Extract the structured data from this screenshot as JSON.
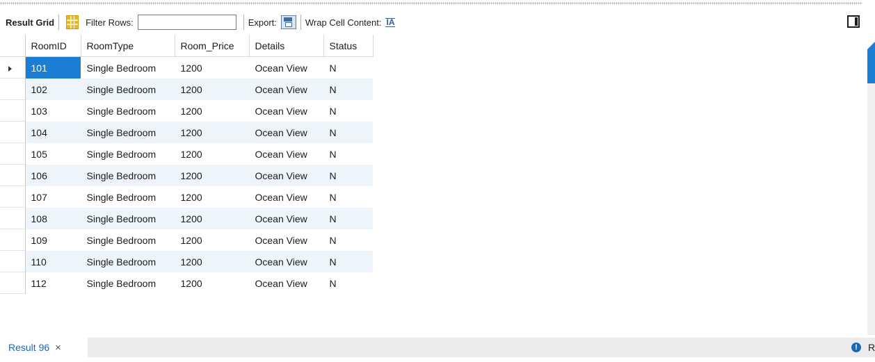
{
  "toolbar": {
    "result_grid_label": "Result Grid",
    "filter_rows_label": "Filter Rows:",
    "filter_value": "",
    "export_label": "Export:",
    "wrap_label": "Wrap Cell Content:",
    "wrap_icon_glyph": "ĪA"
  },
  "grid": {
    "columns": [
      "RoomID",
      "RoomType",
      "Room_Price",
      "Details",
      "Status"
    ],
    "rows": [
      [
        "101",
        "Single Bedroom",
        "1200",
        "Ocean View",
        "N"
      ],
      [
        "102",
        "Single Bedroom",
        "1200",
        "Ocean View",
        "N"
      ],
      [
        "103",
        "Single Bedroom",
        "1200",
        "Ocean View",
        "N"
      ],
      [
        "104",
        "Single Bedroom",
        "1200",
        "Ocean View",
        "N"
      ],
      [
        "105",
        "Single Bedroom",
        "1200",
        "Ocean View",
        "N"
      ],
      [
        "106",
        "Single Bedroom",
        "1200",
        "Ocean View",
        "N"
      ],
      [
        "107",
        "Single Bedroom",
        "1200",
        "Ocean View",
        "N"
      ],
      [
        "108",
        "Single Bedroom",
        "1200",
        "Ocean View",
        "N"
      ],
      [
        "109",
        "Single Bedroom",
        "1200",
        "Ocean View",
        "N"
      ],
      [
        "110",
        "Single Bedroom",
        "1200",
        "Ocean View",
        "N"
      ],
      [
        "112",
        "Single Bedroom",
        "1200",
        "Ocean View",
        "N"
      ]
    ],
    "selected_cell_color": "#1a7fd4",
    "alt_row_color": "#eef4fc"
  },
  "tabs": {
    "result_tab_label": "Result 96",
    "close_glyph": "×",
    "right_text": "R",
    "info_glyph": "!"
  }
}
